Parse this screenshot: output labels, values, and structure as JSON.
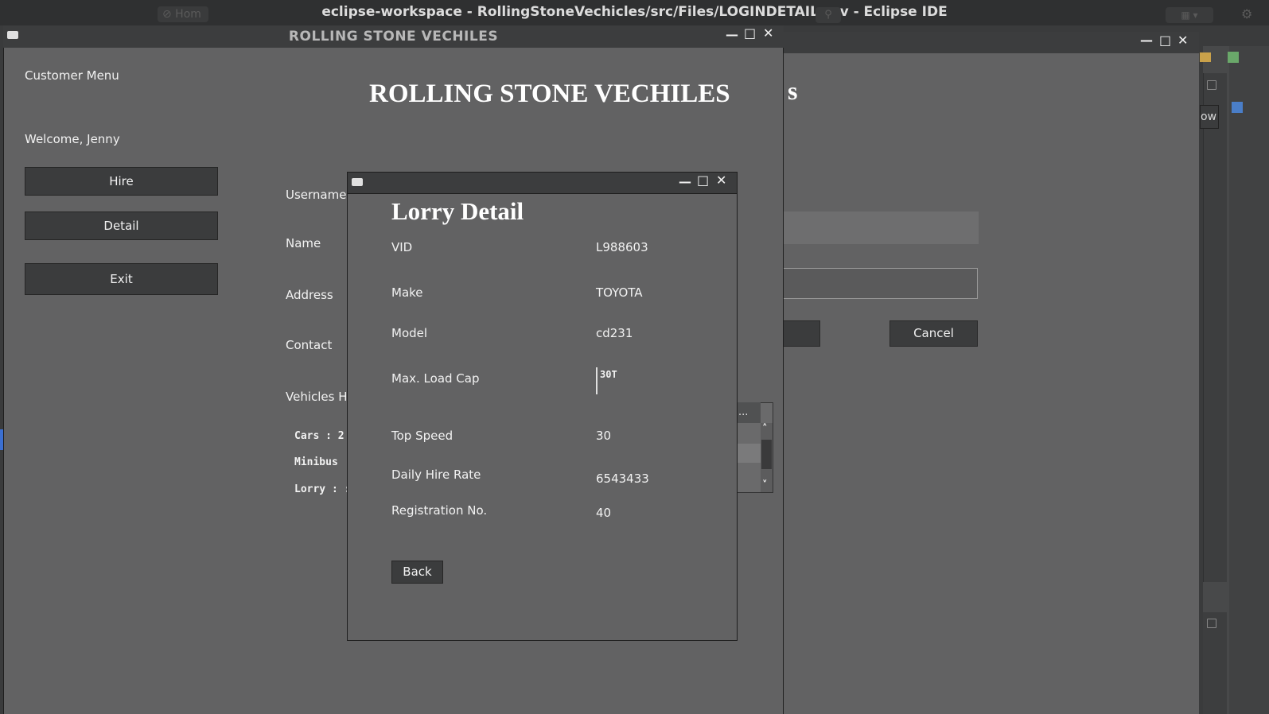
{
  "ide": {
    "title": "eclipse-workspace - RollingStoneVechicles/src/Files/LOGINDETAIL.csv - Eclipse IDE",
    "home_label": "⊘ Hom"
  },
  "main_window": {
    "title": "ROLLING STONE VECHILES",
    "minimize": "—",
    "maximize": "□",
    "close": "✕"
  },
  "sidebar": {
    "menu_label": "Customer Menu",
    "welcome": "Welcome, Jenny",
    "buttons": [
      "Hire",
      "Detail",
      "Exit"
    ]
  },
  "content": {
    "heading": "ROLLING STONE VECHILES",
    "fields": [
      "Username",
      "Name",
      "Address",
      "Contact",
      "Vehicles Hi"
    ],
    "hired_counts": [
      "Cars : 2",
      "Minibus",
      "Lorry : :"
    ],
    "list_header": "..."
  },
  "background_window": {
    "heading_fragment": "s",
    "partial_button": "ow",
    "cancel_label": "Cancel"
  },
  "dialog": {
    "title": "Lorry Detail",
    "rows": [
      {
        "label": "VID",
        "value": "L988603"
      },
      {
        "label": "Make",
        "value": "TOYOTA"
      },
      {
        "label": "Model",
        "value": "cd231"
      },
      {
        "label": "Max. Load Cap",
        "value": "30T"
      },
      {
        "label": "Top Speed",
        "value": "30"
      },
      {
        "label": "Daily Hire Rate",
        "value": "6543433"
      },
      {
        "label": "Registration No.",
        "value": "40"
      }
    ],
    "back_label": "Back"
  },
  "icons": {
    "window_icon": "window-icon",
    "minimize": "minimize-icon",
    "maximize": "maximize-icon",
    "close": "close-icon",
    "scroll_up": "˄",
    "scroll_down": "˅"
  }
}
